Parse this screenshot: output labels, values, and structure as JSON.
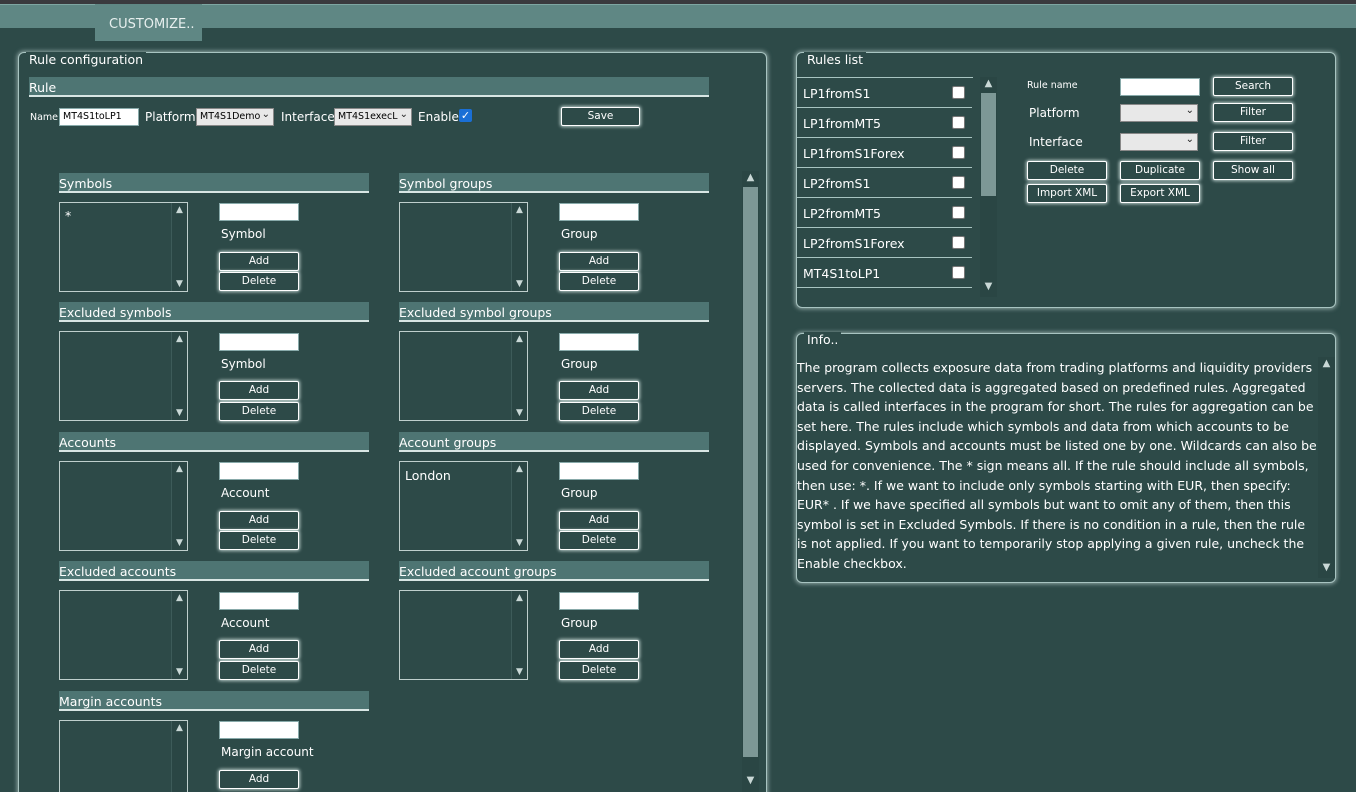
{
  "app": {
    "tab_label": "CUSTOMIZE.."
  },
  "rule_config": {
    "title": "Rule configuration",
    "rule_section": "Rule",
    "name_label": "Name",
    "name_value": "MT4S1toLP1",
    "platform_label": "Platform",
    "platform_value": "MT4S1Demo",
    "interface_label": "Interface",
    "interface_value": "MT4S1execL",
    "enable_label": "Enable",
    "enable_checked": true,
    "save_label": "Save"
  },
  "sections": {
    "symbols": {
      "title": "Symbols",
      "items": [
        "*"
      ],
      "field_label": "Symbol",
      "add": "Add",
      "delete": "Delete"
    },
    "symbol_groups": {
      "title": "Symbol groups",
      "items": [],
      "field_label": "Group",
      "add": "Add",
      "delete": "Delete"
    },
    "excluded_symbols": {
      "title": "Excluded symbols",
      "items": [],
      "field_label": "Symbol",
      "add": "Add",
      "delete": "Delete"
    },
    "excluded_symbol_groups": {
      "title": "Excluded symbol groups",
      "items": [],
      "field_label": "Group",
      "add": "Add",
      "delete": "Delete"
    },
    "accounts": {
      "title": "Accounts",
      "items": [],
      "field_label": "Account",
      "add": "Add",
      "delete": "Delete"
    },
    "account_groups": {
      "title": "Account groups",
      "items": [
        "London"
      ],
      "field_label": "Group",
      "add": "Add",
      "delete": "Delete"
    },
    "excluded_accounts": {
      "title": "Excluded accounts",
      "items": [],
      "field_label": "Account",
      "add": "Add",
      "delete": "Delete"
    },
    "excluded_account_groups": {
      "title": "Excluded account groups",
      "items": [],
      "field_label": "Group",
      "add": "Add",
      "delete": "Delete"
    },
    "margin_accounts": {
      "title": "Margin accounts",
      "items": [],
      "field_label": "Margin account",
      "add": "Add"
    }
  },
  "rules_list": {
    "title": "Rules list",
    "rules": [
      "LP1fromS1",
      "LP1fromMT5",
      "LP1fromS1Forex",
      "LP2fromS1",
      "LP2fromMT5",
      "LP2fromS1Forex",
      "MT4S1toLP1"
    ],
    "rule_name_label": "Rule name",
    "search_label": "Search",
    "platform_label": "Platform",
    "interface_label": "Interface",
    "filter_label": "Filter",
    "delete_label": "Delete",
    "duplicate_label": "Duplicate",
    "show_all_label": "Show all",
    "import_label": "Import XML",
    "export_label": "Export XML"
  },
  "info": {
    "title": "Info..",
    "text": "The program collects exposure data from trading platforms and liquidity providers servers. The collected data is aggregated based on predefined rules. Aggregated data is called interfaces in the program for short. The rules for aggregation can be set here. The rules include which symbols and data from which accounts to be displayed. Symbols and accounts must be listed one by one. Wildcards can also be used for convenience. The * sign means all. If the rule should include all symbols, then use: *. If we want to include only symbols starting with EUR, then specify: EUR* . If we have specified all symbols but want to omit any of them, then this symbol is set in Excluded Symbols. If there is no condition in a rule, then the rule is not applied. If you want to temporarily stop applying a given rule, uncheck the Enable checkbox."
  },
  "colors": {
    "background": "#2d4a48",
    "section_bar": "#4e7573",
    "header": "#5f8784",
    "checkbox_accent": "#1a6fd6"
  },
  "icons": {
    "scroll_up": "chevron-up-icon",
    "scroll_down": "chevron-down-icon",
    "dropdown": "chevron-down-icon",
    "check": "check-icon"
  }
}
